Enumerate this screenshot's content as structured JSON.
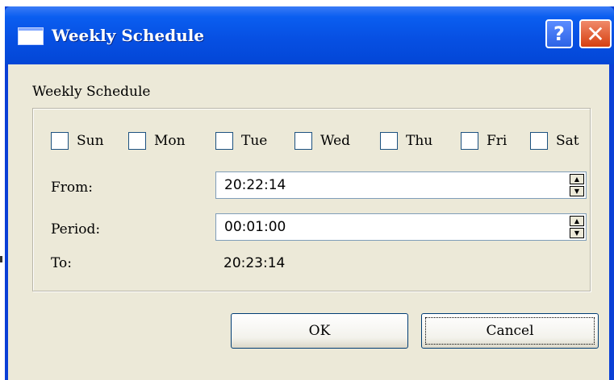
{
  "window": {
    "title": "Weekly Schedule",
    "help_label": "?",
    "close_label": "✕"
  },
  "section": {
    "label": "Weekly Schedule"
  },
  "days": [
    {
      "label": "Sun",
      "checked": false
    },
    {
      "label": "Mon",
      "checked": false
    },
    {
      "label": "Tue",
      "checked": false
    },
    {
      "label": "Wed",
      "checked": false
    },
    {
      "label": "Thu",
      "checked": false
    },
    {
      "label": "Fri",
      "checked": false
    },
    {
      "label": "Sat",
      "checked": false
    }
  ],
  "from": {
    "label": "From:",
    "value": "20:22:14"
  },
  "period": {
    "label": "Period:",
    "value": "00:01:00"
  },
  "to": {
    "label": "To:",
    "value": "20:23:14"
  },
  "buttons": {
    "ok_label": "OK",
    "cancel_label": "Cancel"
  },
  "colors": {
    "titlebar": "#0750e3",
    "dialog_bg": "#ece9d8",
    "close_button": "#d64010",
    "help_button": "#2c63e6"
  }
}
